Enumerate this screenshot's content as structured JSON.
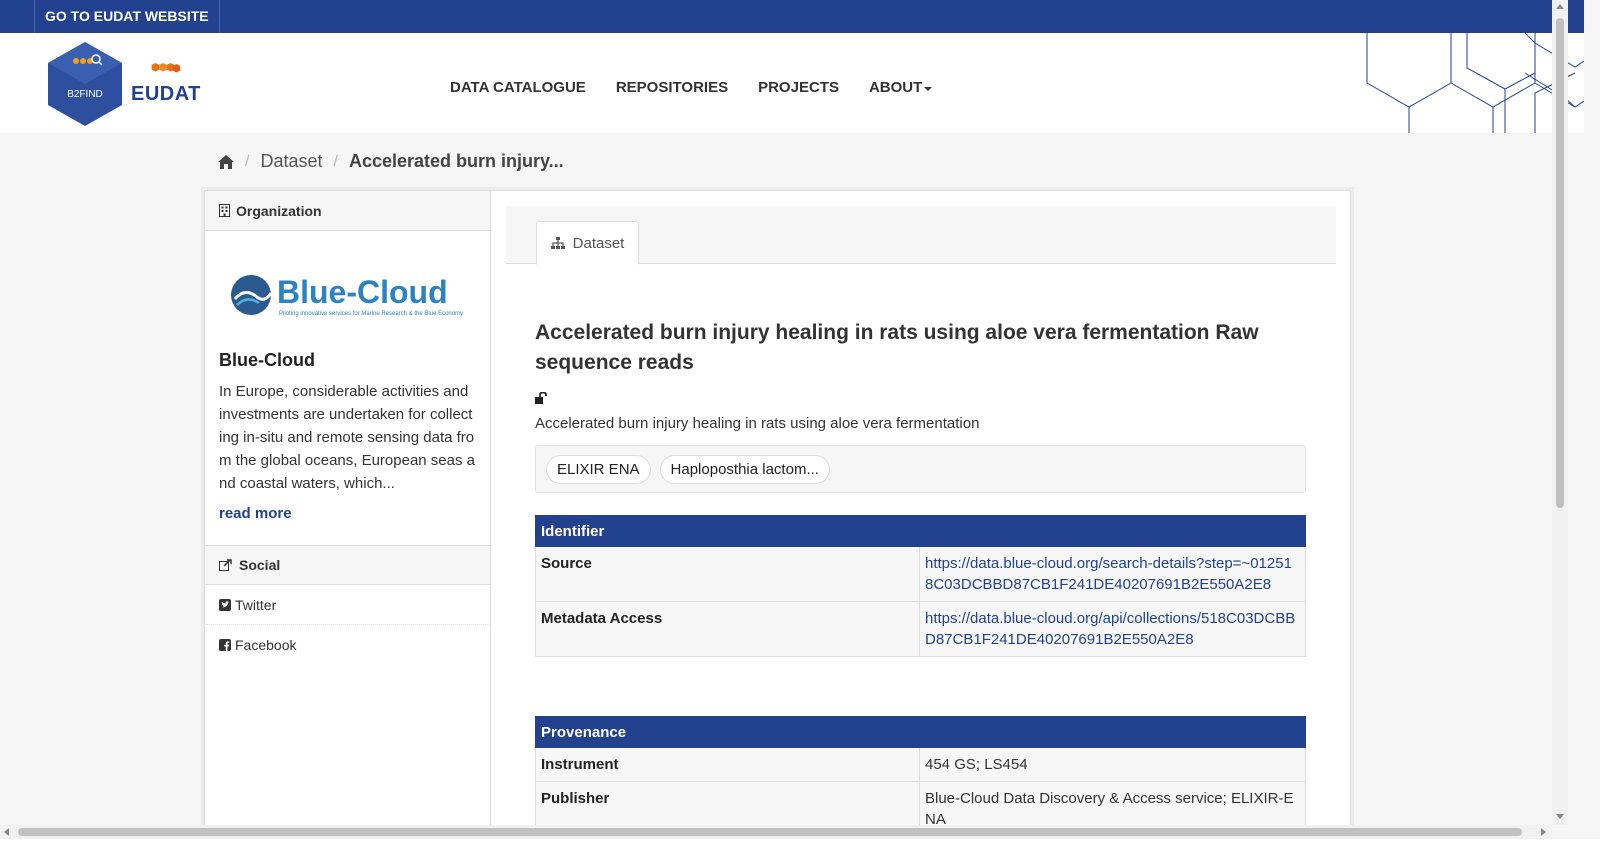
{
  "topbar": {
    "link_label": "GO TO EUDAT WEBSITE"
  },
  "header": {
    "b2find_logo_text": "B2FIND",
    "eudat_logo_text": "EUDAT",
    "nav": [
      {
        "label": "DATA CATALOGUE"
      },
      {
        "label": "REPOSITORIES"
      },
      {
        "label": "PROJECTS"
      },
      {
        "label": "ABOUT"
      }
    ]
  },
  "breadcrumb": {
    "level1": "Dataset",
    "current": "Accelerated burn injury..."
  },
  "sidebar": {
    "organization_heading": "Organization",
    "org_logo_text": "Blue-Cloud",
    "org_logo_tagline": "Piloting innovative services for Marine Research & the Blue Economy",
    "org_name": "Blue-Cloud",
    "org_description": "In Europe, considerable activities and investments are undertaken for collecting in-situ and remote sensing data from the global oceans, European seas and coastal waters, which...",
    "read_more": "read more",
    "social_heading": "Social",
    "social_items": [
      {
        "label": "Twitter"
      },
      {
        "label": "Facebook"
      }
    ]
  },
  "content": {
    "tab_label": "Dataset",
    "title": "Accelerated burn injury healing in rats using aloe vera fermentation Raw sequence reads",
    "subtitle": "Accelerated burn injury healing in rats using aloe vera fermentation",
    "tags": [
      "ELIXIR ENA",
      "Haploposthia lactom..."
    ],
    "identifier": {
      "heading": "Identifier",
      "rows": [
        {
          "key": "Source",
          "value": "https://data.blue-cloud.org/search-details?step=~012518C03DCBBD87CB1F241DE40207691B2E550A2E8"
        },
        {
          "key": "Metadata Access",
          "value": "https://data.blue-cloud.org/api/collections/518C03DCBBD87CB1F241DE40207691B2E550A2E8"
        }
      ]
    },
    "provenance": {
      "heading": "Provenance",
      "rows": [
        {
          "key": "Instrument",
          "value": "454 GS; LS454"
        },
        {
          "key": "Publisher",
          "value": "Blue-Cloud Data Discovery & Access service; ELIXIR-ENA"
        }
      ]
    }
  },
  "colors": {
    "brand_blue": "#22428f",
    "logo_hex": "#2d4f9e",
    "logo_orange": "#e8701a"
  }
}
